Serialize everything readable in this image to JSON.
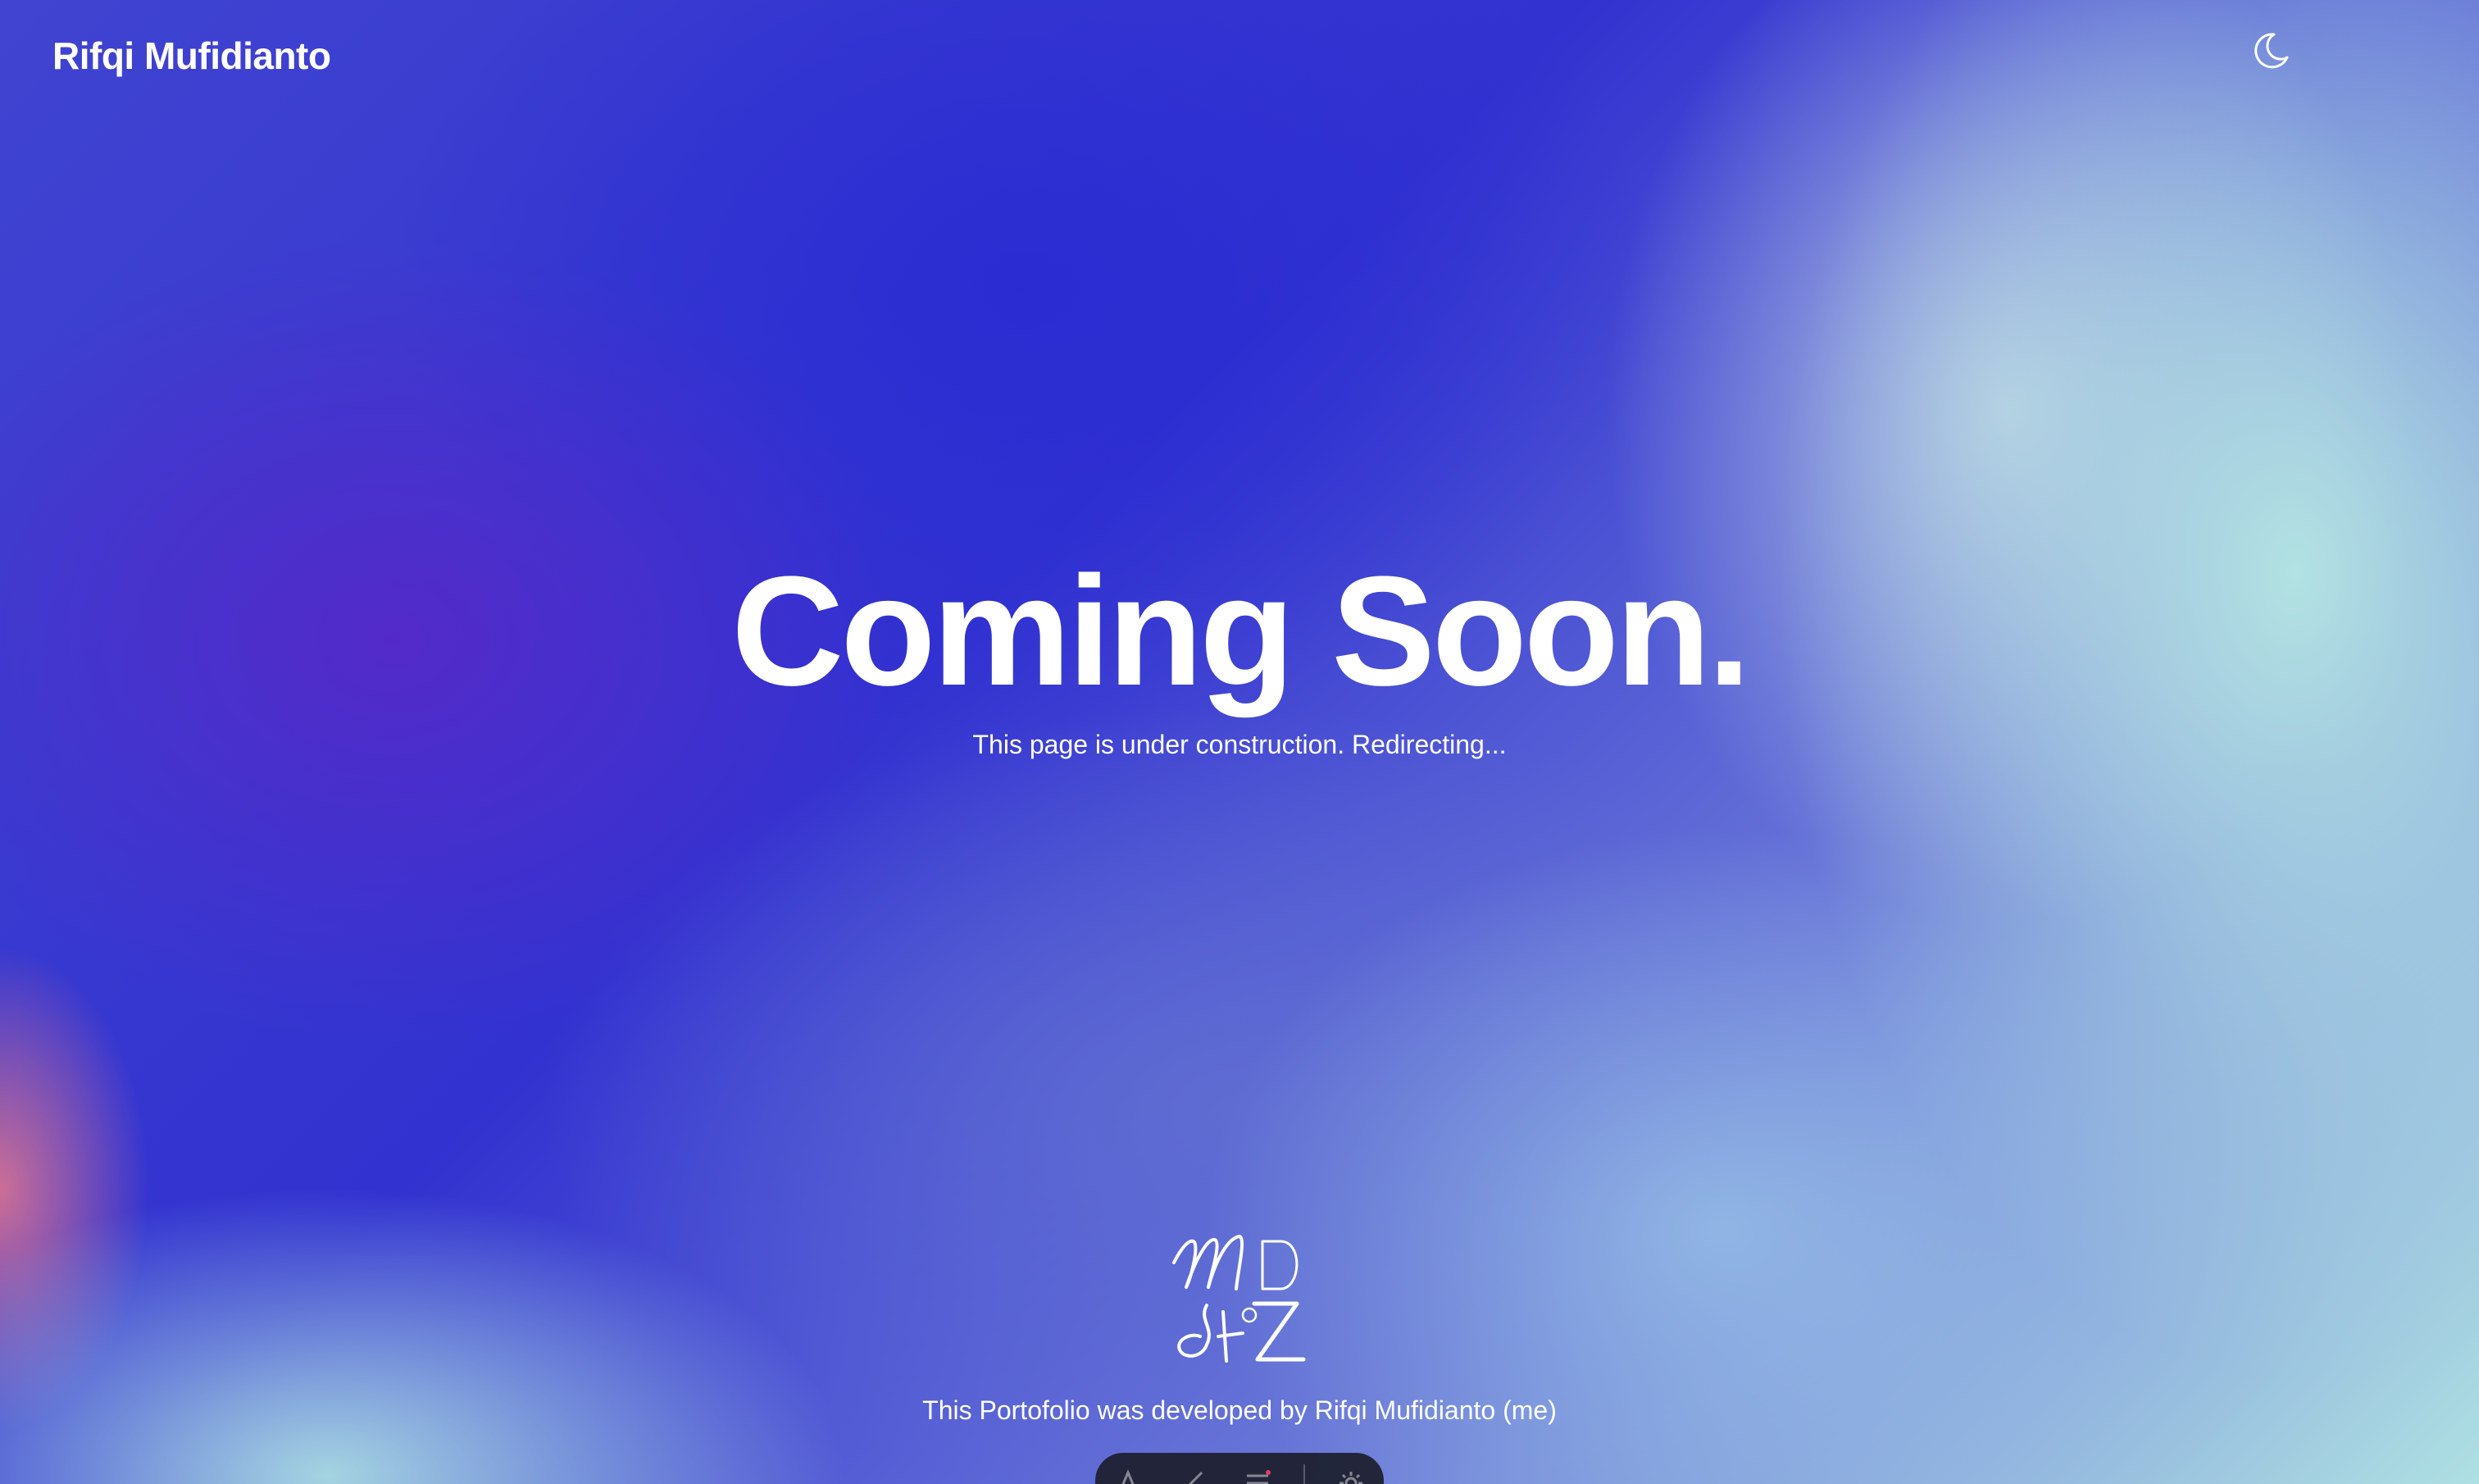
{
  "header": {
    "brand": "Rifqi Mufidianto",
    "theme_toggle_icon": "moon-icon"
  },
  "hero": {
    "title": "Coming Soon.",
    "subtitle": "This page is under construction. Redirecting..."
  },
  "footer": {
    "logo_icon": "signature-logo",
    "credit": "This Portofolio was developed by Rifqi Mufidianto (me)"
  },
  "dock": {
    "items": [
      {
        "icon": "font-icon"
      },
      {
        "icon": "brush-icon"
      },
      {
        "icon": "menu-icon"
      },
      {
        "icon": "settings-icon"
      }
    ]
  },
  "colors": {
    "primary_blue": "#3232d0",
    "mint": "#aee0e2",
    "text": "#ffffff"
  }
}
